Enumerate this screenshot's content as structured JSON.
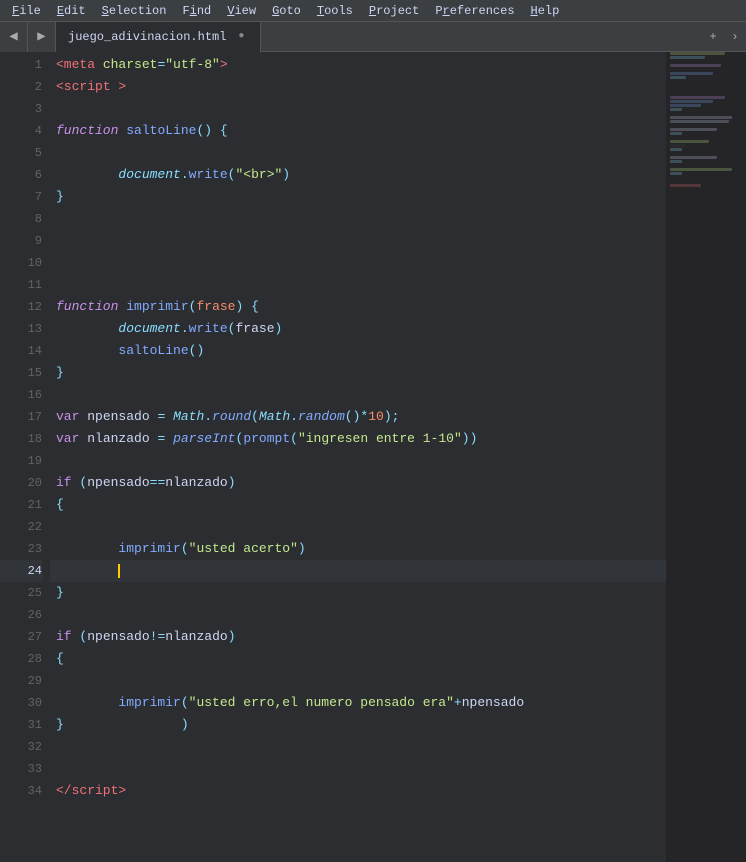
{
  "menubar": {
    "items": [
      {
        "label": "File",
        "underline": "F",
        "id": "file"
      },
      {
        "label": "Edit",
        "underline": "E",
        "id": "edit"
      },
      {
        "label": "Selection",
        "underline": "S",
        "id": "selection"
      },
      {
        "label": "Find",
        "underline": "i",
        "id": "find"
      },
      {
        "label": "View",
        "underline": "V",
        "id": "view"
      },
      {
        "label": "Goto",
        "underline": "G",
        "id": "goto"
      },
      {
        "label": "Tools",
        "underline": "T",
        "id": "tools"
      },
      {
        "label": "Project",
        "underline": "P",
        "id": "project"
      },
      {
        "label": "Preferences",
        "underline": "r",
        "id": "preferences"
      },
      {
        "label": "Help",
        "underline": "H",
        "id": "help"
      }
    ]
  },
  "tabbar": {
    "filename": "juego_adivinacion.html",
    "modified": false
  },
  "editor": {
    "active_line": 24,
    "total_lines": 34
  }
}
